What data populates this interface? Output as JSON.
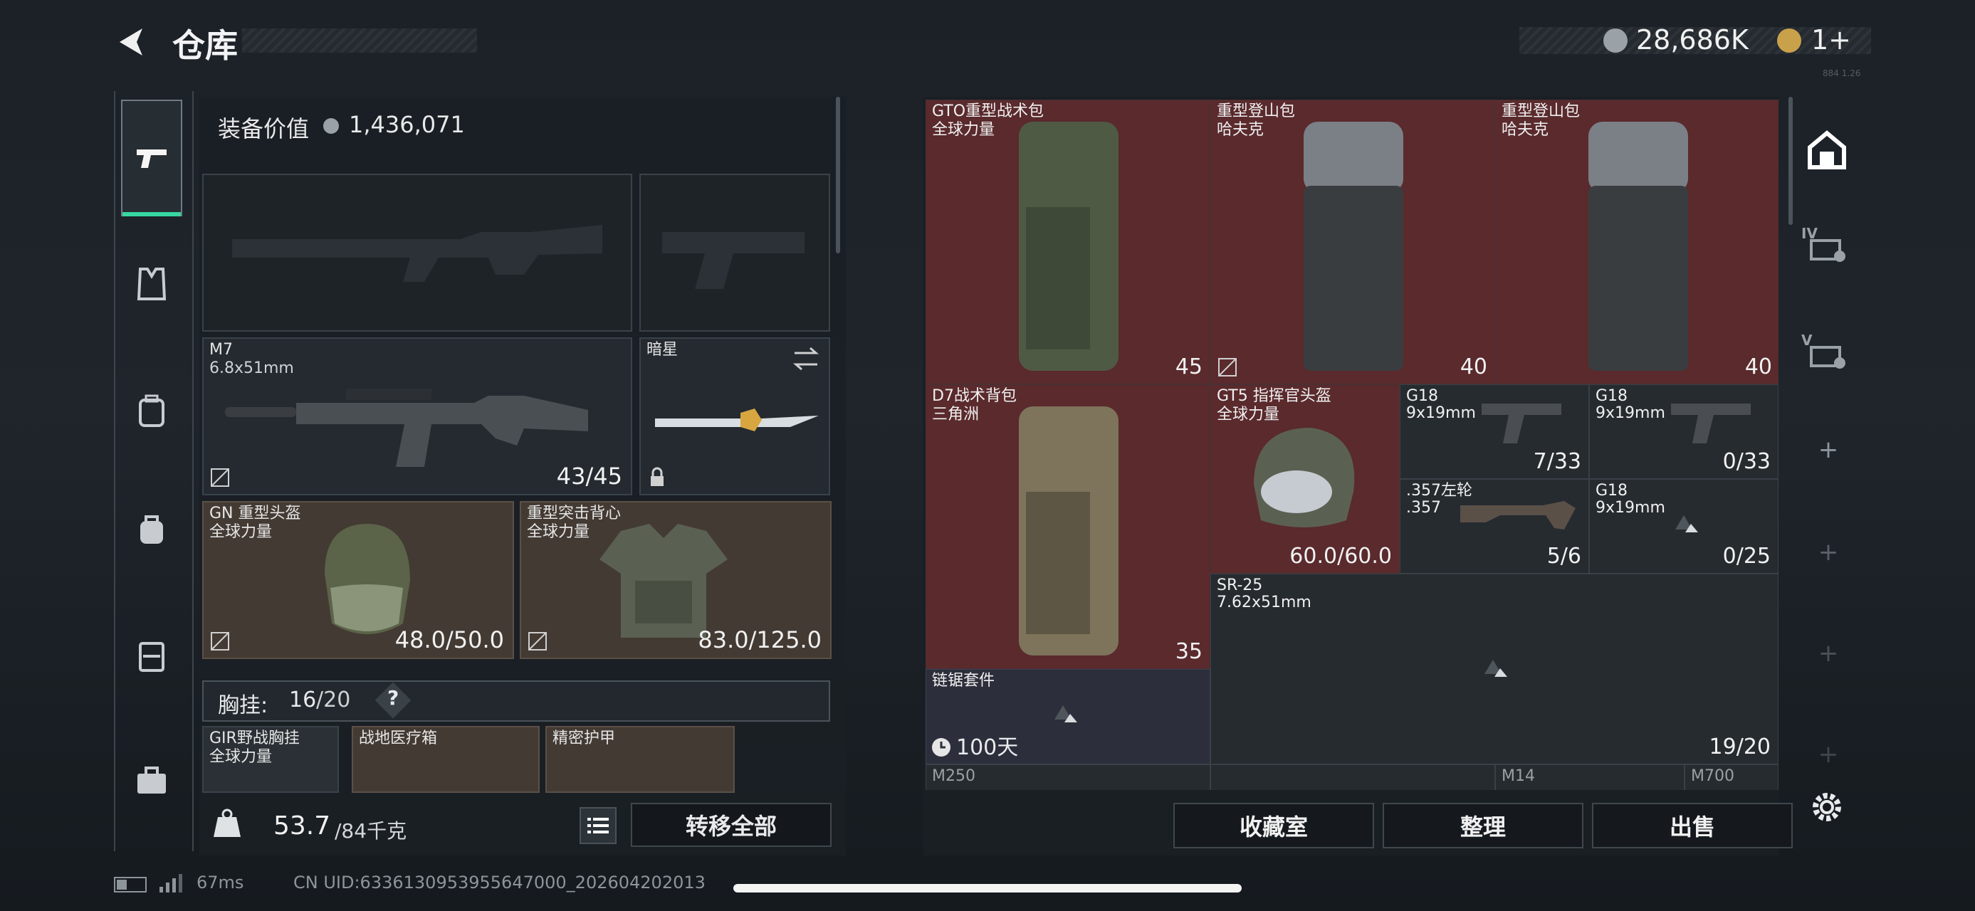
{
  "header": {
    "title": "仓库",
    "currency": "28,686K",
    "tickets": "1+",
    "tiny_right": "884 1.26"
  },
  "nav": {
    "items": [
      "pistol",
      "armor-vest",
      "backpack-1",
      "backpack-2",
      "storage-box",
      "case"
    ]
  },
  "loadout": {
    "value_label": "装备价值",
    "value": "1,436,071",
    "primary": {
      "name": "M7",
      "caliber": "6.8x51mm",
      "ammo": "43/45"
    },
    "melee": {
      "name": "暗星"
    },
    "helmet": {
      "name": "GN 重型头盔",
      "sub": "全球力量",
      "durability": "48.0/50.0"
    },
    "armor": {
      "name": "重型突击背心",
      "sub": "全球力量",
      "durability": "83.0/125.0"
    },
    "rig": {
      "label": "胸挂:",
      "count": "16",
      "capacity": "/20",
      "help": "?"
    },
    "rig_items": [
      {
        "name": "GIR野战胸挂",
        "sub": "全球力量"
      },
      {
        "name": "战地医疗箱",
        "sub": ""
      },
      {
        "name": "精密护甲",
        "sub": ""
      }
    ],
    "weight": "53.7",
    "weight_max": "/84千克",
    "transfer_all": "转移全部"
  },
  "stash": {
    "items": [
      {
        "name": "GTO重型战术包",
        "sub": "全球力量",
        "val": "45"
      },
      {
        "name": "重型登山包",
        "sub": "哈夫克",
        "val": "40"
      },
      {
        "name": "重型登山包",
        "sub": "哈夫克",
        "val": "40"
      },
      {
        "name": "D7战术背包",
        "sub": "三角洲",
        "val": "35"
      },
      {
        "name": "GT5 指挥官头盔",
        "sub": "全球力量",
        "val": "60.0/60.0"
      },
      {
        "name": "G18",
        "sub": "9x19mm",
        "val": "7/33"
      },
      {
        "name": "G18",
        "sub": "9x19mm",
        "val": "0/33"
      },
      {
        "name": ".357左轮",
        "sub": ".357",
        "val": "5/6"
      },
      {
        "name": "G18",
        "sub": "9x19mm",
        "val": "0/25"
      },
      {
        "name": "SR-25",
        "sub": "7.62x51mm",
        "val": "19/20"
      },
      {
        "name": "链锯套件",
        "sub": "",
        "val": "100天"
      },
      {
        "name": "M250",
        "sub": "",
        "val": ""
      },
      {
        "name": "M14",
        "sub": "",
        "val": ""
      },
      {
        "name": "M700",
        "sub": "",
        "val": ""
      }
    ],
    "buttons": {
      "collection": "收藏室",
      "sort": "整理",
      "sell": "出售"
    },
    "side_tabs": [
      "IV",
      "V"
    ]
  },
  "status": {
    "ping": "67ms",
    "uid": "CN UID:6336130953955647000_202604202013"
  },
  "colors": {
    "accent": "#37d6a0",
    "item_red": "#5a2a2d",
    "slot_brown": "#433a33"
  }
}
